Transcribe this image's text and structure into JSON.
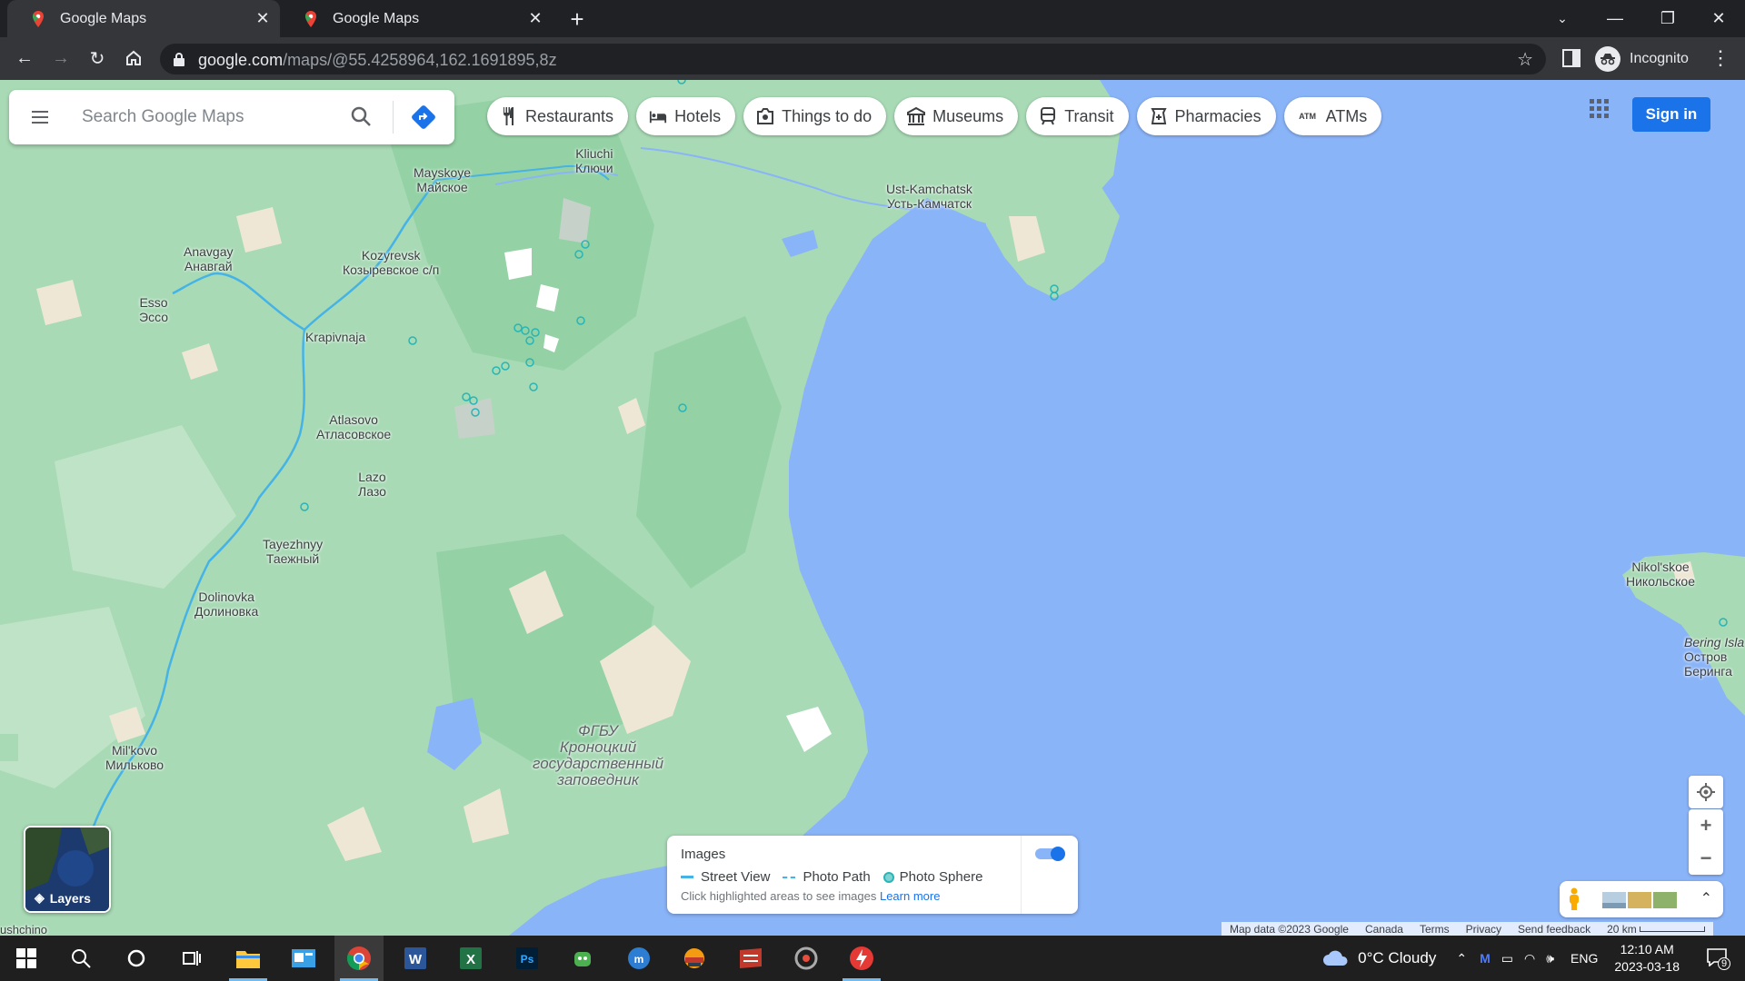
{
  "browser": {
    "tabs": [
      {
        "title": "Google Maps",
        "active": true
      },
      {
        "title": "Google Maps",
        "active": false
      }
    ],
    "url_host": "google.com",
    "url_path": "/maps/@55.4258964,162.1691895,8z",
    "profile_label": "Incognito"
  },
  "maps": {
    "search_placeholder": "Search Google Maps",
    "chips": [
      {
        "label": "Restaurants",
        "icon": "fork-knife-icon"
      },
      {
        "label": "Hotels",
        "icon": "bed-icon"
      },
      {
        "label": "Things to do",
        "icon": "camera-icon"
      },
      {
        "label": "Museums",
        "icon": "museum-icon"
      },
      {
        "label": "Transit",
        "icon": "train-icon"
      },
      {
        "label": "Pharmacies",
        "icon": "pharmacy-icon"
      },
      {
        "label": "ATMs",
        "icon": "atm-icon"
      }
    ],
    "sign_in": "Sign in",
    "layers_label": "Layers",
    "places": [
      {
        "en": "Kliuchi",
        "ru": "Ключи"
      },
      {
        "en": "Mayskoye",
        "ru": "Майское"
      },
      {
        "en": "Ust-Kamchatsk",
        "ru": "Усть-Камчатск"
      },
      {
        "en": "Kozyrevsk",
        "ru": "Козыревское с/п"
      },
      {
        "en": "Anavgay",
        "ru": "Анавгай"
      },
      {
        "en": "Esso",
        "ru": "Эссо"
      },
      {
        "en": "Krapivnaja",
        "ru": ""
      },
      {
        "en": "Atlasovo",
        "ru": "Атласовское"
      },
      {
        "en": "Lazo",
        "ru": "Лазо"
      },
      {
        "en": "Tayezhnyy",
        "ru": "Таежный"
      },
      {
        "en": "Dolinovka",
        "ru": "Долиновка"
      },
      {
        "en": "Mil'kovo",
        "ru": "Мильково"
      },
      {
        "en": "Nikol'skoe",
        "ru": "Никольское"
      },
      {
        "en": "Bering Isla",
        "ru": "Остров"
      },
      {
        "en": "",
        "ru": "Беринга"
      },
      {
        "en": "ushchino",
        "ru": ""
      }
    ],
    "reserve": [
      "ФГБУ",
      "Кроноцкий",
      "государственный",
      "заповедник"
    ],
    "images_panel": {
      "title": "Images",
      "street_view": "Street View",
      "photo_path": "Photo Path",
      "photo_sphere": "Photo Sphere",
      "hint": "Click highlighted areas to see images",
      "learn_more": "Learn more",
      "toggle_on": true
    },
    "attribution": {
      "map_data": "Map data ©2023 Google",
      "region": "Canada",
      "terms": "Terms",
      "privacy": "Privacy",
      "feedback": "Send feedback",
      "scale": "20 km"
    }
  },
  "taskbar": {
    "weather": "0°C  Cloudy",
    "lang": "ENG",
    "time": "12:10 AM",
    "date": "2023-03-18",
    "notifications": "9"
  },
  "colors": {
    "land": "#a8dab5",
    "water": "#8ab4f8",
    "accent": "#1a73e8"
  }
}
